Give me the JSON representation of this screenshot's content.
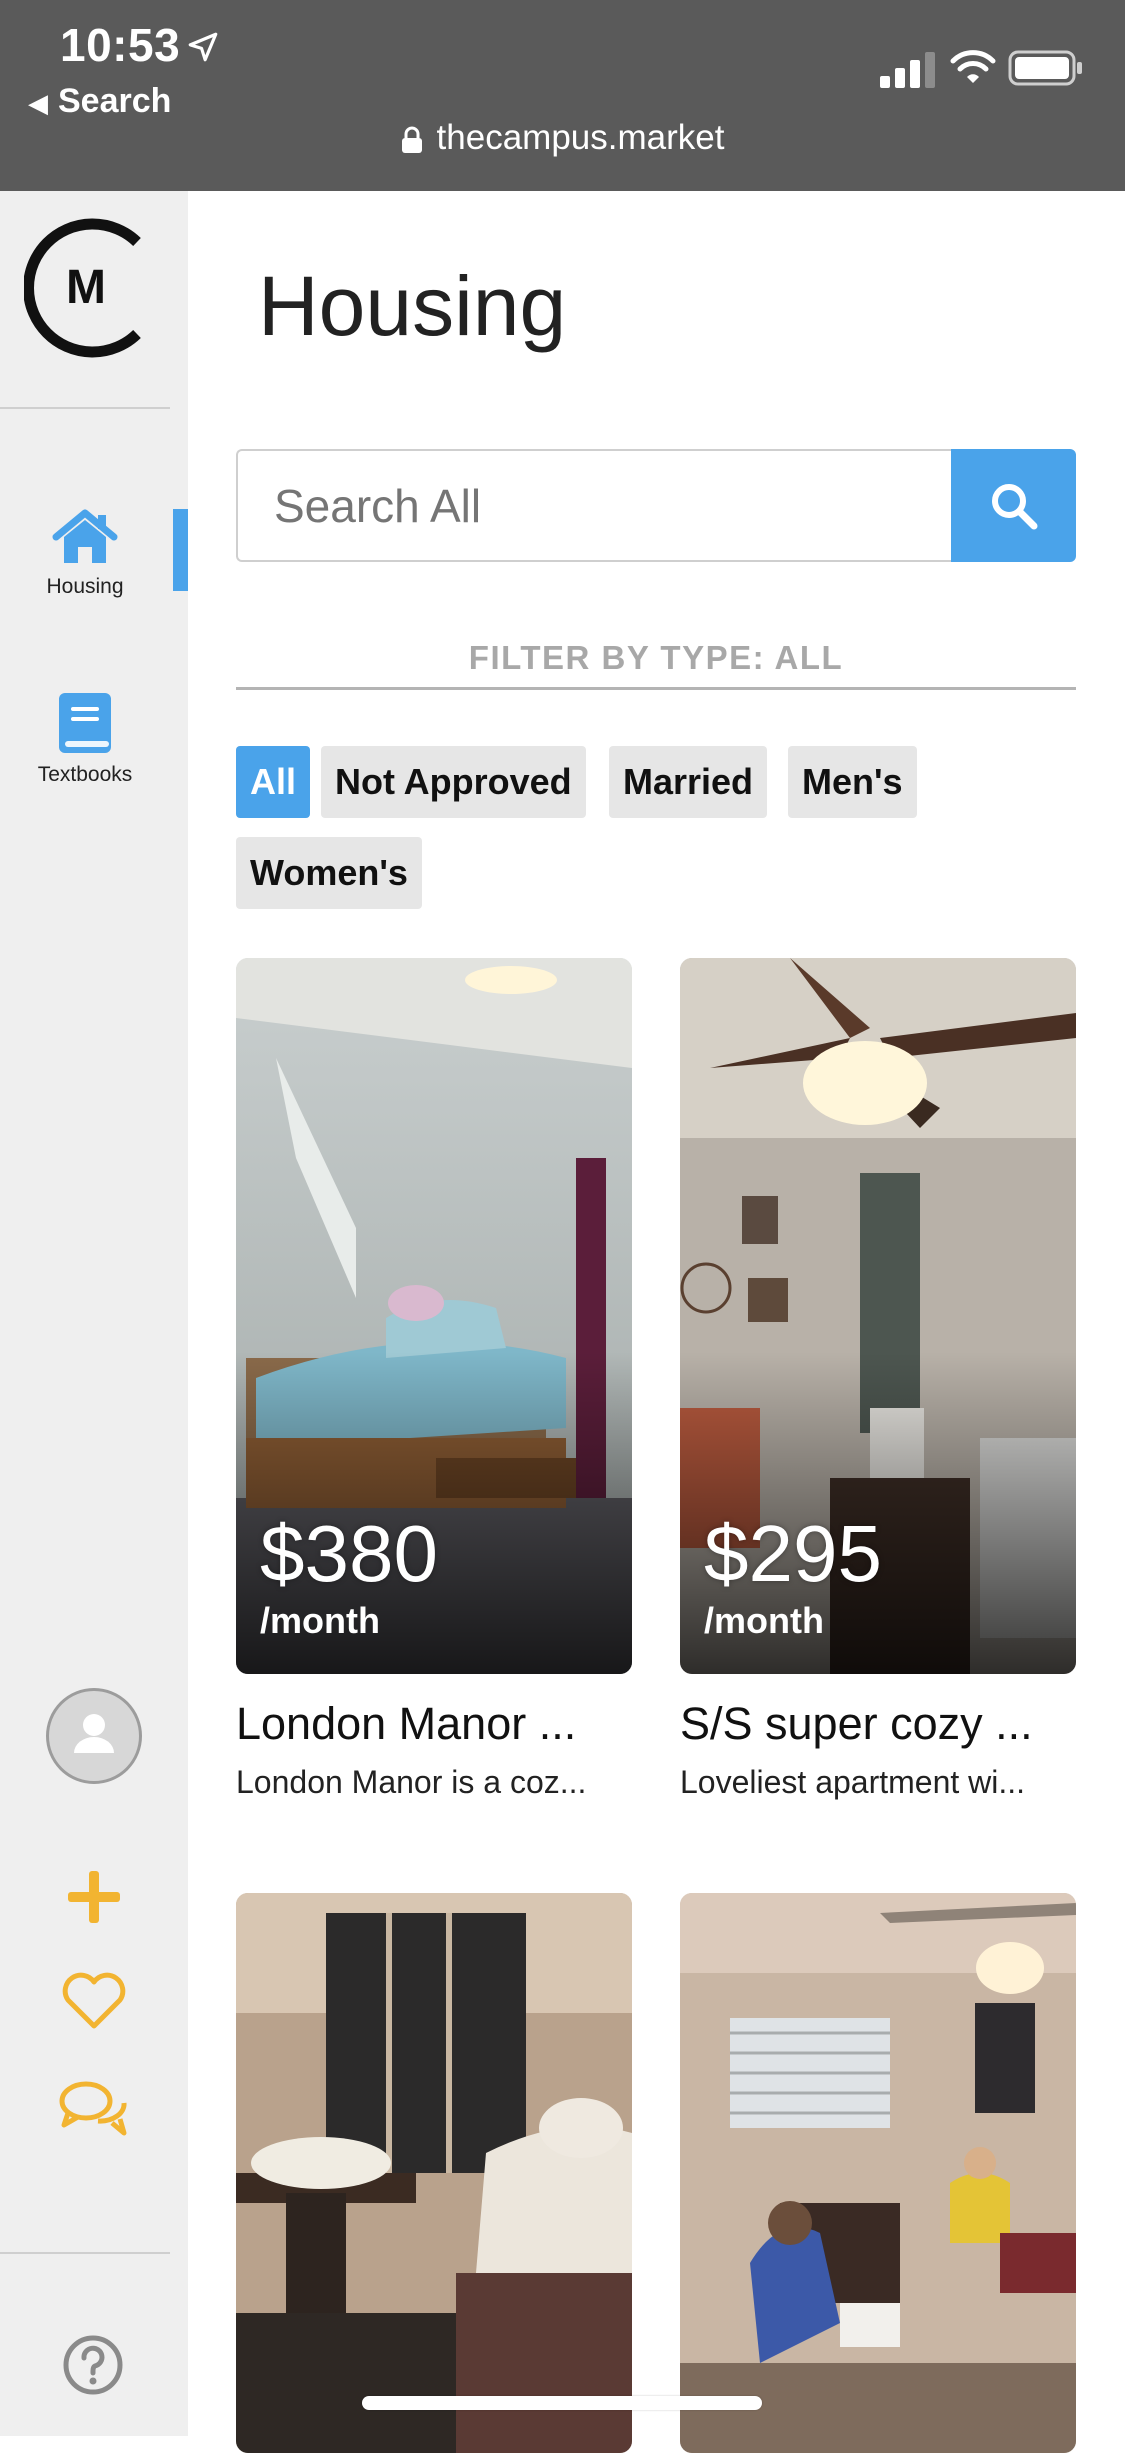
{
  "status_bar": {
    "time": "10:53",
    "back_label": "Search",
    "url": "thecampus.market",
    "icons": [
      "location-arrow-icon",
      "signal-icon",
      "wifi-icon",
      "battery-icon",
      "lock-icon"
    ]
  },
  "sidebar": {
    "logo_text": "M",
    "items": [
      {
        "label": "Housing",
        "icon": "house-icon",
        "active": true
      },
      {
        "label": "Textbooks",
        "icon": "book-icon",
        "active": false
      }
    ],
    "actions": [
      "avatar",
      "plus-icon",
      "heart-icon",
      "chat-icon",
      "help-icon"
    ],
    "colors": {
      "accent": "#4aa3ea",
      "action": "#f2b431",
      "background": "#efefef"
    }
  },
  "main": {
    "title": "Housing",
    "search": {
      "placeholder": "Search All"
    },
    "filter_label": "FILTER BY TYPE: ALL",
    "filters": [
      {
        "label": "All",
        "active": true
      },
      {
        "label": "Not Approved",
        "active": false
      },
      {
        "label": "Married",
        "active": false
      },
      {
        "label": "Men's",
        "active": false
      },
      {
        "label": "Women's",
        "active": false
      }
    ],
    "listings": [
      {
        "price": "$380",
        "period": "/month",
        "title": "London Manor ...",
        "description": "London Manor is a coz..."
      },
      {
        "price": "$295",
        "period": "/month",
        "title": "S/S super cozy ...",
        "description": "Loveliest apartment wi..."
      },
      {
        "price": "",
        "period": "",
        "title": "",
        "description": ""
      },
      {
        "price": "",
        "period": "",
        "title": "",
        "description": ""
      }
    ]
  }
}
